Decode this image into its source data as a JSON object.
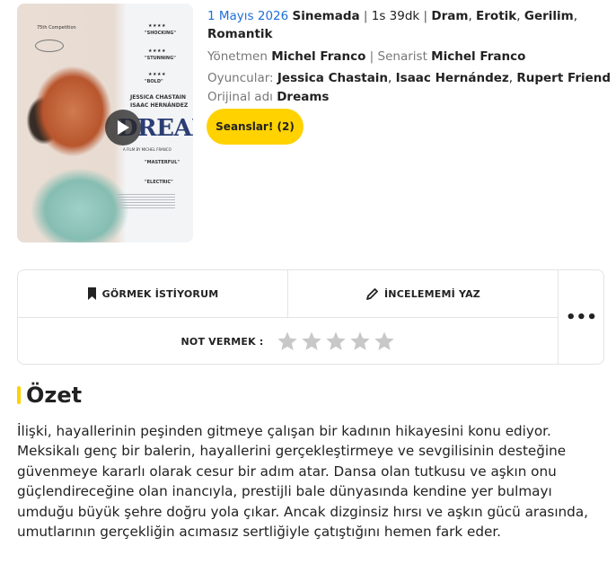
{
  "poster": {
    "title": "DREAMS",
    "cast_line_1": "JESSICA CHASTAIN",
    "cast_line_2": "ISAAC HERNÁNDEZ",
    "festival": "75th Competition",
    "byline": "A FILM BY MICHEL FRANCO",
    "quote_1": "\"SHOCKING\"",
    "quote_2": "\"STUNNING\"",
    "quote_3": "\"BOLD\"",
    "quote_4": "\"MASTERFUL\"",
    "quote_5": "\"ELECTRIC\"",
    "stars": "★★★★"
  },
  "info": {
    "release_date": "1 Mayıs 2026",
    "status": "Sinemada",
    "duration": "1s 39dk",
    "genres": [
      "Dram",
      "Erotik",
      "Gerilim",
      "Romantik"
    ],
    "director_label": "Yönetmen",
    "director": "Michel Franco",
    "writer_label": "Senarist",
    "writer": "Michel Franco",
    "cast_label": "Oyuncular:",
    "cast": [
      "Jessica Chastain",
      "Isaac Hernández",
      "Rupert Friend"
    ],
    "original_title_label": "Orijinal adı",
    "original_title": "Dreams",
    "seanslar_button": "Seanslar! (2)"
  },
  "actions": {
    "watchlist_label": "GÖRMEK İSTİYORUM",
    "review_label": "İNCELEMEMİ YAZ",
    "rate_label": "NOT VERMEK :",
    "more_label": "•••",
    "rating": 0,
    "star_count": 5
  },
  "summary": {
    "title": "Özet",
    "text": "İlişki, hayallerinin peşinden gitmeye çalışan bir kadının hikayesini konu ediyor. Meksikalı genç bir balerin, hayallerini gerçekleştirmeye ve sevgilisinin desteğine güvenmeye kararlı olarak cesur bir adım atar. Dansa olan tutkusu ve aşkın onu güçlendireceğine olan inancıyla, prestijli bale dünyasında kendine yer bulmayı umduğu büyük şehre doğru yola çıkar. Ancak dizginsiz hırsı ve aşkın gücü arasında, umutlarının gerçekliğin acımasız sertliğiyle çatıştığını hemen fark eder."
  },
  "colors": {
    "accent": "#ffd200",
    "date_blue": "#1e6fd9",
    "star_empty": "#c8c8c8"
  }
}
